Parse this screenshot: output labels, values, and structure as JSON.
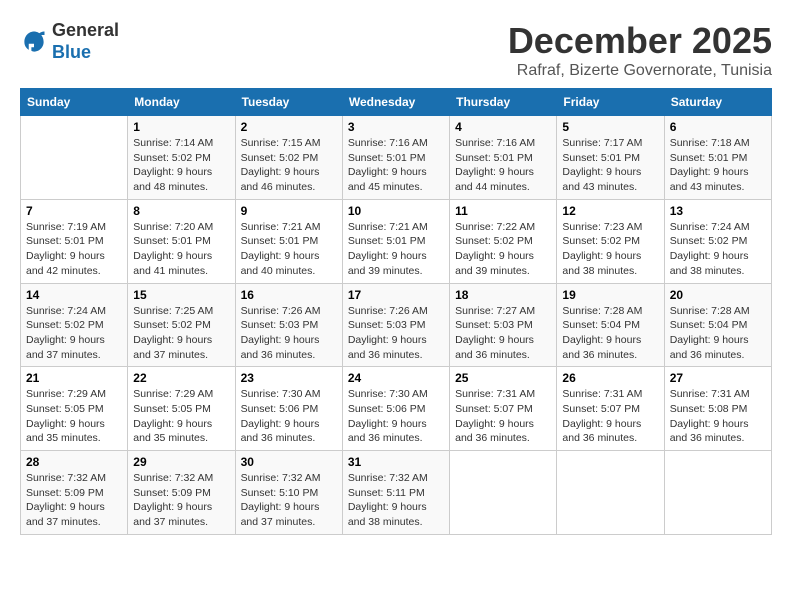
{
  "header": {
    "logo_general": "General",
    "logo_blue": "Blue",
    "month_year": "December 2025",
    "location": "Rafraf, Bizerte Governorate, Tunisia"
  },
  "days_of_week": [
    "Sunday",
    "Monday",
    "Tuesday",
    "Wednesday",
    "Thursday",
    "Friday",
    "Saturday"
  ],
  "weeks": [
    [
      {
        "day": "",
        "sunrise": "",
        "sunset": "",
        "daylight": ""
      },
      {
        "day": "1",
        "sunrise": "Sunrise: 7:14 AM",
        "sunset": "Sunset: 5:02 PM",
        "daylight": "Daylight: 9 hours and 48 minutes."
      },
      {
        "day": "2",
        "sunrise": "Sunrise: 7:15 AM",
        "sunset": "Sunset: 5:02 PM",
        "daylight": "Daylight: 9 hours and 46 minutes."
      },
      {
        "day": "3",
        "sunrise": "Sunrise: 7:16 AM",
        "sunset": "Sunset: 5:01 PM",
        "daylight": "Daylight: 9 hours and 45 minutes."
      },
      {
        "day": "4",
        "sunrise": "Sunrise: 7:16 AM",
        "sunset": "Sunset: 5:01 PM",
        "daylight": "Daylight: 9 hours and 44 minutes."
      },
      {
        "day": "5",
        "sunrise": "Sunrise: 7:17 AM",
        "sunset": "Sunset: 5:01 PM",
        "daylight": "Daylight: 9 hours and 43 minutes."
      },
      {
        "day": "6",
        "sunrise": "Sunrise: 7:18 AM",
        "sunset": "Sunset: 5:01 PM",
        "daylight": "Daylight: 9 hours and 43 minutes."
      }
    ],
    [
      {
        "day": "7",
        "sunrise": "Sunrise: 7:19 AM",
        "sunset": "Sunset: 5:01 PM",
        "daylight": "Daylight: 9 hours and 42 minutes."
      },
      {
        "day": "8",
        "sunrise": "Sunrise: 7:20 AM",
        "sunset": "Sunset: 5:01 PM",
        "daylight": "Daylight: 9 hours and 41 minutes."
      },
      {
        "day": "9",
        "sunrise": "Sunrise: 7:21 AM",
        "sunset": "Sunset: 5:01 PM",
        "daylight": "Daylight: 9 hours and 40 minutes."
      },
      {
        "day": "10",
        "sunrise": "Sunrise: 7:21 AM",
        "sunset": "Sunset: 5:01 PM",
        "daylight": "Daylight: 9 hours and 39 minutes."
      },
      {
        "day": "11",
        "sunrise": "Sunrise: 7:22 AM",
        "sunset": "Sunset: 5:02 PM",
        "daylight": "Daylight: 9 hours and 39 minutes."
      },
      {
        "day": "12",
        "sunrise": "Sunrise: 7:23 AM",
        "sunset": "Sunset: 5:02 PM",
        "daylight": "Daylight: 9 hours and 38 minutes."
      },
      {
        "day": "13",
        "sunrise": "Sunrise: 7:24 AM",
        "sunset": "Sunset: 5:02 PM",
        "daylight": "Daylight: 9 hours and 38 minutes."
      }
    ],
    [
      {
        "day": "14",
        "sunrise": "Sunrise: 7:24 AM",
        "sunset": "Sunset: 5:02 PM",
        "daylight": "Daylight: 9 hours and 37 minutes."
      },
      {
        "day": "15",
        "sunrise": "Sunrise: 7:25 AM",
        "sunset": "Sunset: 5:02 PM",
        "daylight": "Daylight: 9 hours and 37 minutes."
      },
      {
        "day": "16",
        "sunrise": "Sunrise: 7:26 AM",
        "sunset": "Sunset: 5:03 PM",
        "daylight": "Daylight: 9 hours and 36 minutes."
      },
      {
        "day": "17",
        "sunrise": "Sunrise: 7:26 AM",
        "sunset": "Sunset: 5:03 PM",
        "daylight": "Daylight: 9 hours and 36 minutes."
      },
      {
        "day": "18",
        "sunrise": "Sunrise: 7:27 AM",
        "sunset": "Sunset: 5:03 PM",
        "daylight": "Daylight: 9 hours and 36 minutes."
      },
      {
        "day": "19",
        "sunrise": "Sunrise: 7:28 AM",
        "sunset": "Sunset: 5:04 PM",
        "daylight": "Daylight: 9 hours and 36 minutes."
      },
      {
        "day": "20",
        "sunrise": "Sunrise: 7:28 AM",
        "sunset": "Sunset: 5:04 PM",
        "daylight": "Daylight: 9 hours and 36 minutes."
      }
    ],
    [
      {
        "day": "21",
        "sunrise": "Sunrise: 7:29 AM",
        "sunset": "Sunset: 5:05 PM",
        "daylight": "Daylight: 9 hours and 35 minutes."
      },
      {
        "day": "22",
        "sunrise": "Sunrise: 7:29 AM",
        "sunset": "Sunset: 5:05 PM",
        "daylight": "Daylight: 9 hours and 35 minutes."
      },
      {
        "day": "23",
        "sunrise": "Sunrise: 7:30 AM",
        "sunset": "Sunset: 5:06 PM",
        "daylight": "Daylight: 9 hours and 36 minutes."
      },
      {
        "day": "24",
        "sunrise": "Sunrise: 7:30 AM",
        "sunset": "Sunset: 5:06 PM",
        "daylight": "Daylight: 9 hours and 36 minutes."
      },
      {
        "day": "25",
        "sunrise": "Sunrise: 7:31 AM",
        "sunset": "Sunset: 5:07 PM",
        "daylight": "Daylight: 9 hours and 36 minutes."
      },
      {
        "day": "26",
        "sunrise": "Sunrise: 7:31 AM",
        "sunset": "Sunset: 5:07 PM",
        "daylight": "Daylight: 9 hours and 36 minutes."
      },
      {
        "day": "27",
        "sunrise": "Sunrise: 7:31 AM",
        "sunset": "Sunset: 5:08 PM",
        "daylight": "Daylight: 9 hours and 36 minutes."
      }
    ],
    [
      {
        "day": "28",
        "sunrise": "Sunrise: 7:32 AM",
        "sunset": "Sunset: 5:09 PM",
        "daylight": "Daylight: 9 hours and 37 minutes."
      },
      {
        "day": "29",
        "sunrise": "Sunrise: 7:32 AM",
        "sunset": "Sunset: 5:09 PM",
        "daylight": "Daylight: 9 hours and 37 minutes."
      },
      {
        "day": "30",
        "sunrise": "Sunrise: 7:32 AM",
        "sunset": "Sunset: 5:10 PM",
        "daylight": "Daylight: 9 hours and 37 minutes."
      },
      {
        "day": "31",
        "sunrise": "Sunrise: 7:32 AM",
        "sunset": "Sunset: 5:11 PM",
        "daylight": "Daylight: 9 hours and 38 minutes."
      },
      {
        "day": "",
        "sunrise": "",
        "sunset": "",
        "daylight": ""
      },
      {
        "day": "",
        "sunrise": "",
        "sunset": "",
        "daylight": ""
      },
      {
        "day": "",
        "sunrise": "",
        "sunset": "",
        "daylight": ""
      }
    ]
  ]
}
